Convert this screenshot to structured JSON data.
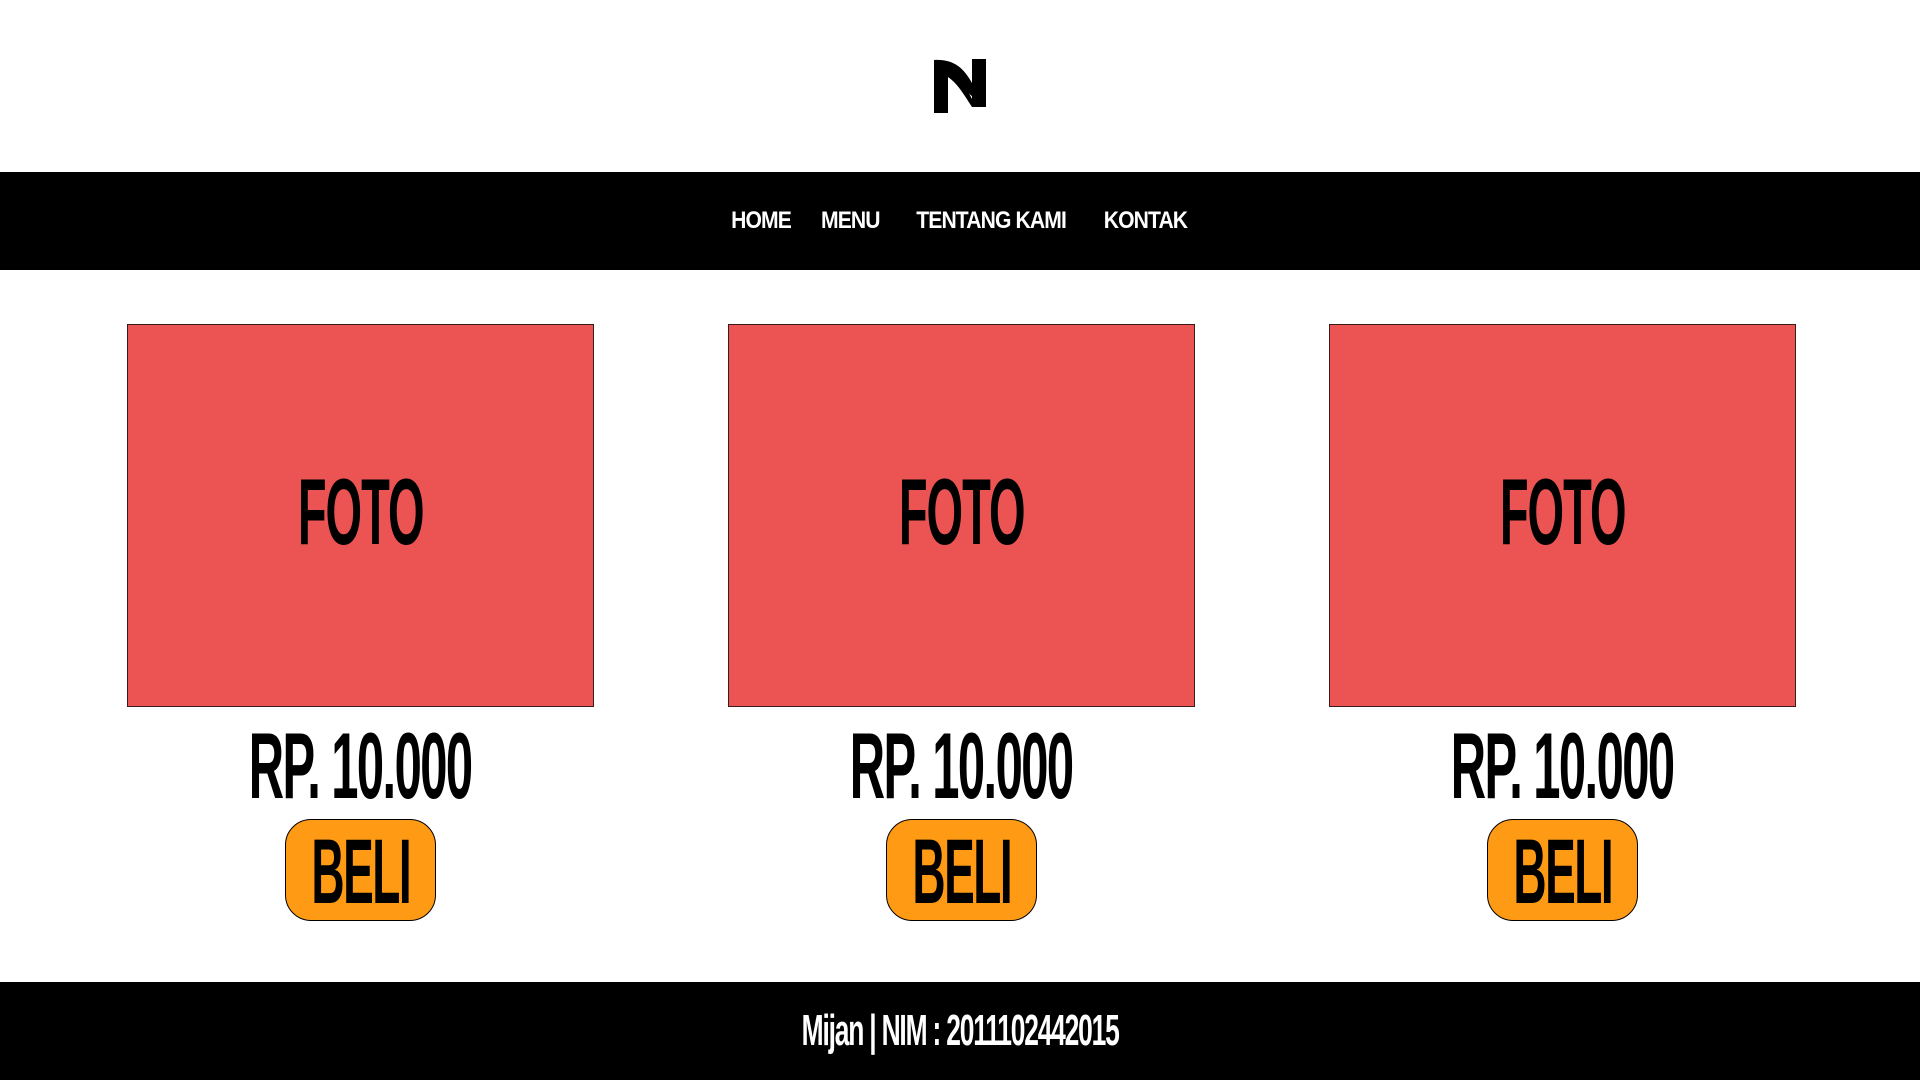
{
  "header": {
    "logo_icon": "n-logo-icon"
  },
  "nav": {
    "items": [
      {
        "label": "HOME"
      },
      {
        "label": "MENU"
      },
      {
        "label": "TENTANG KAMI"
      },
      {
        "label": "KONTAK"
      }
    ]
  },
  "products": [
    {
      "photo_label": "FOTO",
      "price": "RP. 10.000",
      "buy_label": "BELI"
    },
    {
      "photo_label": "FOTO",
      "price": "RP. 10.000",
      "buy_label": "BELI"
    },
    {
      "photo_label": "FOTO",
      "price": "RP. 10.000",
      "buy_label": "BELI"
    }
  ],
  "footer": {
    "text": "Mijan | NIM : 2011102442015"
  },
  "colors": {
    "photo_bg": "#eb5453",
    "button_bg": "#ff9a14",
    "bar_bg": "#000000",
    "page_bg": "#ffffff"
  }
}
